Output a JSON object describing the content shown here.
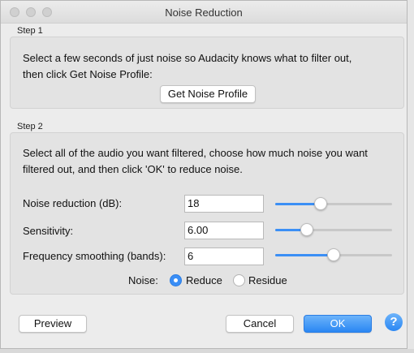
{
  "dialog": {
    "title": "Noise Reduction"
  },
  "step1": {
    "label": "Step 1",
    "line1": "Select a few seconds of just noise so Audacity knows what to filter out,",
    "line2": "then click Get Noise Profile:",
    "button": "Get Noise Profile"
  },
  "step2": {
    "label": "Step 2",
    "line1": "Select all of the audio you want filtered, choose how much noise you want",
    "line2": "filtered out, and then click 'OK' to reduce noise.",
    "params": [
      {
        "label": "Noise reduction (dB):",
        "value": "18",
        "slider": 0.39
      },
      {
        "label": "Sensitivity:",
        "value": "6.00",
        "slider": 0.27
      },
      {
        "label": "Frequency smoothing (bands):",
        "value": "6",
        "slider": 0.5
      }
    ],
    "noise_label": "Noise:",
    "options": [
      {
        "label": "Reduce",
        "selected": true
      },
      {
        "label": "Residue",
        "selected": false
      }
    ]
  },
  "buttons": {
    "preview": "Preview",
    "cancel": "Cancel",
    "ok": "OK",
    "help": "?"
  },
  "colors": {
    "accent": "#3b8ff5",
    "window_bg": "#ececec"
  }
}
